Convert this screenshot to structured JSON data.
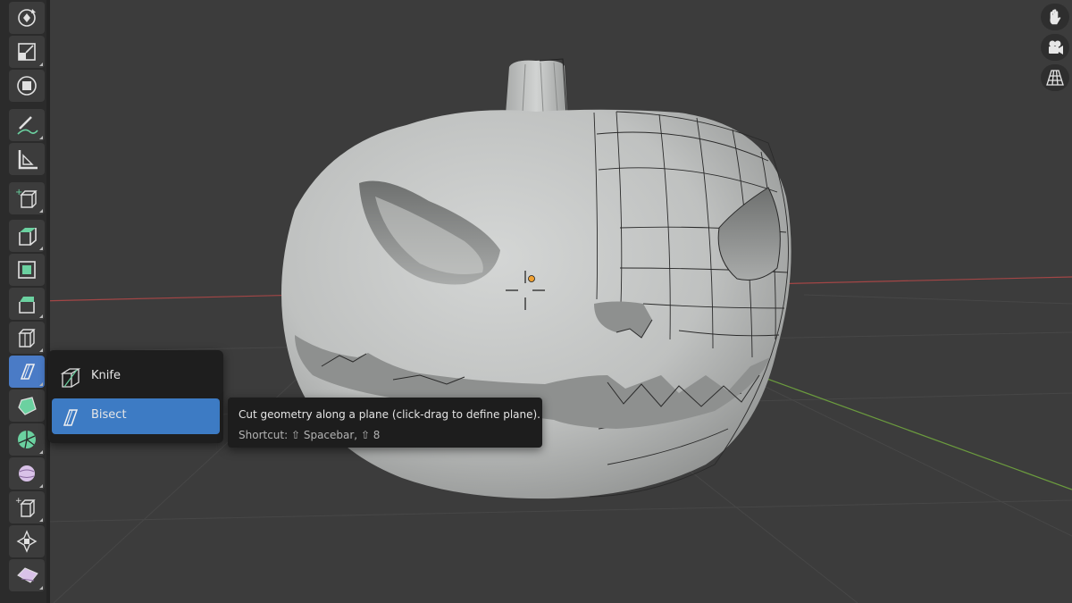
{
  "toolbar": {
    "tools": [
      {
        "name": "rotate-tool",
        "icon": "rotate-icon"
      },
      {
        "name": "scale-tool",
        "icon": "scale-icon"
      },
      {
        "name": "transform-tool",
        "icon": "transform-icon"
      },
      {
        "name": "annotate-tool",
        "icon": "annotate-icon"
      },
      {
        "name": "measure-tool",
        "icon": "measure-icon"
      },
      {
        "name": "add-cube-tool",
        "icon": "add-cube-icon"
      },
      {
        "name": "extrude-region-tool",
        "icon": "extrude-region-icon"
      },
      {
        "name": "inset-faces-tool",
        "icon": "inset-faces-icon"
      },
      {
        "name": "bevel-tool",
        "icon": "bevel-icon"
      },
      {
        "name": "loop-cut-tool",
        "icon": "loop-cut-icon"
      },
      {
        "name": "knife-group-tool",
        "icon": "knife-icon"
      },
      {
        "name": "poly-build-tool",
        "icon": "poly-build-icon"
      },
      {
        "name": "spin-tool",
        "icon": "spin-icon"
      },
      {
        "name": "smooth-tool",
        "icon": "smooth-icon"
      },
      {
        "name": "shear-tool",
        "icon": "shear-icon"
      },
      {
        "name": "shrink-fatten-tool",
        "icon": "shrink-fatten-icon"
      },
      {
        "name": "rip-region-tool",
        "icon": "rip-region-icon"
      }
    ]
  },
  "nav_gizmo": [
    "hand-pan-icon",
    "camera-icon",
    "perspective-grid-icon"
  ],
  "popup_menu": {
    "items": [
      {
        "label": "Knife",
        "icon": "knife-icon",
        "active": false
      },
      {
        "label": "Bisect",
        "icon": "bisect-icon",
        "active": true
      }
    ]
  },
  "tooltip": {
    "description": "Cut geometry along a plane (click-drag to define plane).",
    "shortcut": "Shortcut: ⇧ Spacebar, ⇧ 8"
  },
  "colors": {
    "active_tool": "#4a7bc6",
    "popup_active": "#3d7bc4",
    "x_axis": "#a34646",
    "y_axis": "#6b9b3e",
    "model": "#c7c9c8"
  }
}
